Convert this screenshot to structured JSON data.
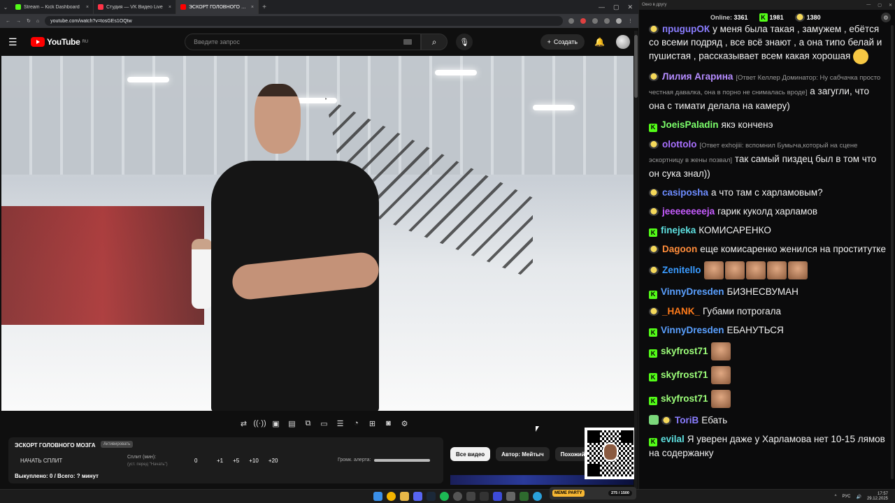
{
  "browser": {
    "tabs": [
      {
        "title": "Stream – Kick Dashboard",
        "color": "#53fc18",
        "active": false
      },
      {
        "title": "Студия — VK Видео Live",
        "color": "#ff3347",
        "active": false
      },
      {
        "title": "ЭСКОРТ ГОЛОВНОГО МОЗ...",
        "color": "#ff0000",
        "active": true
      }
    ],
    "url": "youtube.com/watch?v=tosGEs1OQtw",
    "close_glyph": "×",
    "new_tab_glyph": "+",
    "win_controls": [
      "—",
      "▢",
      "✕"
    ]
  },
  "youtube": {
    "logo_text": "YouTube",
    "region": "RU",
    "search_placeholder": "Введите запрос",
    "create_label": "Создать",
    "menu_glyph": "☰",
    "search_glyph": "⌕",
    "mic_glyph": "🎙",
    "bell_glyph": "🔔",
    "chips": [
      "Все видео",
      "Автор: Мейтыч",
      "Похожий"
    ]
  },
  "player": {
    "buttons": [
      "⇄",
      "((·))",
      "▣",
      "▤",
      "⧉",
      "▭",
      "☰",
      "◔",
      "⊞",
      "◙",
      "⚙"
    ]
  },
  "overlay": {
    "title": "ЭСКОРТ ГОЛОВНОГО МОЗГА",
    "badge": "Активировать",
    "start_split": "НАЧАТЬ СПЛИТ",
    "split_label": "Сплит (мин):",
    "split_sub": "(уст. перед \"Начать\")",
    "split_value": "0",
    "steps": [
      "+1",
      "+5",
      "+10",
      "+20"
    ],
    "alert_label": "Громк. алерта:",
    "alert_volume": 1.0,
    "bought": "Выкуплено: 0 / Всего: ? минут"
  },
  "chat": {
    "window_title": "Окно в другу",
    "online_label": "Online:",
    "online_count": "3361",
    "kick_count": "1981",
    "other_count": "1380",
    "messages": [
      {
        "platform": "face",
        "name": "прuguрОК",
        "color": "#8a7dff",
        "reply": "",
        "text": "у меня была такая , замужем , ебётся со всеми подряд , все всё знают , а она типо белай и пушистая , рассказывает всем какая хорошая",
        "emotes": 0,
        "emoji": true
      },
      {
        "platform": "face",
        "name": "Лилия Агарина",
        "color": "#b58cff",
        "reply": "[Ответ Келлер Доминатор: Ну сабчачка просто честная давалка, она в порно не снималась вроде]",
        "text": "а загугли, что она с тимати делала на камеру)",
        "emotes": 0,
        "emoji": false
      },
      {
        "platform": "kick",
        "name": "JoeisPaladin",
        "color": "#7cff6b",
        "reply": "",
        "text": "якэ конченэ",
        "emotes": 0,
        "emoji": false
      },
      {
        "platform": "face",
        "name": "olottolo",
        "color": "#a970ff",
        "reply": "[Ответ exhojiii: вспомнил Бумыча,который на сцене эскортницу в жены позвал]",
        "text": "так самый пиздец был в том что он сука знал))",
        "emotes": 0,
        "emoji": false
      },
      {
        "platform": "face",
        "name": "casiposha",
        "color": "#6d8cff",
        "reply": "",
        "text": "а что там с харламовым?",
        "emotes": 0,
        "emoji": false
      },
      {
        "platform": "face",
        "name": "jeeeeeeeeja",
        "color": "#c65cff",
        "reply": "",
        "text": "гарик куколд харламов",
        "emotes": 0,
        "emoji": false
      },
      {
        "platform": "kick",
        "name": "finejeka",
        "color": "#5ee0e0",
        "reply": "",
        "text": "КОМИСАРЕНКО",
        "emotes": 0,
        "emoji": false
      },
      {
        "platform": "face",
        "name": "Dagoon",
        "color": "#ff8c3a",
        "reply": "",
        "text": "еще комисаренко женился на проститутке",
        "emotes": 0,
        "emoji": false
      },
      {
        "platform": "face",
        "name": "Zenitello",
        "color": "#3a9bff",
        "reply": "",
        "text": "",
        "emotes": 5,
        "emoji": false
      },
      {
        "platform": "kick",
        "name": "VinnyDresden",
        "color": "#5aa0ff",
        "reply": "",
        "text": "БИЗНЕСВУМАН",
        "emotes": 0,
        "emoji": false
      },
      {
        "platform": "face",
        "name": "_HANK_",
        "color": "#ff7a1a",
        "reply": "",
        "text": "Губами потрогала",
        "emotes": 0,
        "emoji": false
      },
      {
        "platform": "kick",
        "name": "VinnyDresden",
        "color": "#5aa0ff",
        "reply": "",
        "text": "ЕБАНУТЬСЯ",
        "emotes": 0,
        "emoji": false
      },
      {
        "platform": "kick",
        "name": "skyfrost71",
        "color": "#9dff7a",
        "reply": "",
        "text": "",
        "emotes": 1,
        "emoji": false
      },
      {
        "platform": "kick",
        "name": "skyfrost71",
        "color": "#9dff7a",
        "reply": "",
        "text": "",
        "emotes": 1,
        "emoji": false
      },
      {
        "platform": "kick",
        "name": "skyfrost71",
        "color": "#9dff7a",
        "reply": "",
        "text": "",
        "emotes": 1,
        "emoji": false
      },
      {
        "platform": "shield",
        "name": "ToriB",
        "color": "#8a7dff",
        "reply": "",
        "text": "Ебать",
        "emotes": 0,
        "emoji": false
      },
      {
        "platform": "kick",
        "name": "evilal",
        "color": "#5ee0e0",
        "reply": "",
        "text": "Я уверен даже у Харламова нет 10-15 лямов на содержанку",
        "emotes": 0,
        "emoji": false
      }
    ]
  },
  "taskbar": {
    "widget_logo": "MEME PARTY",
    "widget_progress": "275 / 1500",
    "lang": "РУС",
    "time": "17:57",
    "date": "29.12.2025"
  }
}
